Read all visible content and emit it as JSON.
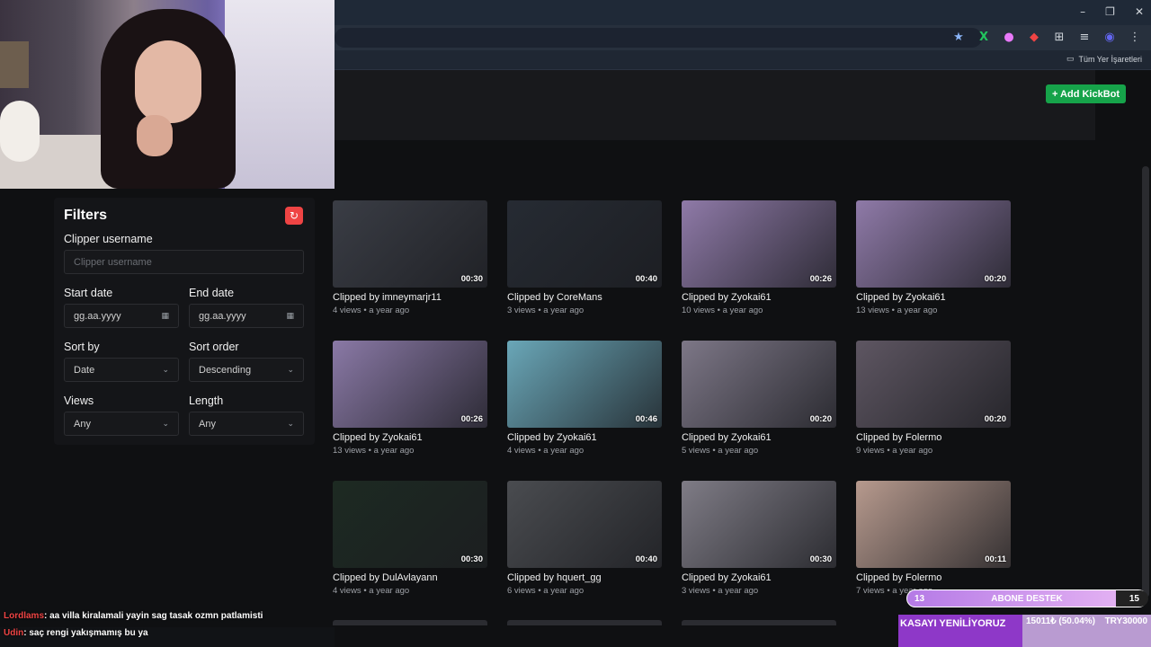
{
  "browser": {
    "bookmark_label": "Tüm Yer İşaretleri",
    "extensions": [
      "star-icon",
      "x-ext-icon",
      "pink-ext-icon",
      "red-ext-icon",
      "puzzle-icon",
      "media-icon",
      "profile-icon",
      "menu-icon"
    ],
    "window_controls": [
      "–",
      "❐",
      "✕"
    ]
  },
  "header": {
    "add_button_label": "+ Add KickBot"
  },
  "filters": {
    "title": "Filters",
    "clipper_label": "Clipper username",
    "clipper_placeholder": "Clipper username",
    "start_label": "Start date",
    "start_value": "gg.aa.yyyy",
    "end_label": "End date",
    "end_value": "gg.aa.yyyy",
    "sortby_label": "Sort by",
    "sortby_value": "Date",
    "sortorder_label": "Sort order",
    "sortorder_value": "Descending",
    "views_label": "Views",
    "views_value": "Any",
    "length_label": "Length",
    "length_value": "Any"
  },
  "clips": [
    {
      "title": "Clipped by imneymarjr11",
      "meta": "4 views • a year ago",
      "duration": "00:30",
      "thumb": "#3a3d45"
    },
    {
      "title": "Clipped by CoreMans",
      "meta": "3 views • a year ago",
      "duration": "00:40",
      "thumb": "#262b33"
    },
    {
      "title": "Clipped by Zyokai61",
      "meta": "10 views • a year ago",
      "duration": "00:26",
      "thumb": "#8f7aa8"
    },
    {
      "title": "Clipped by Zyokai61",
      "meta": "13 views • a year ago",
      "duration": "00:20",
      "thumb": "#8f7aa8"
    },
    {
      "title": "Clipped by Zyokai61",
      "meta": "13 views • a year ago",
      "duration": "00:26",
      "thumb": "#8a79a6"
    },
    {
      "title": "Clipped by Zyokai61",
      "meta": "4 views • a year ago",
      "duration": "00:46",
      "thumb": "#6aa7b8"
    },
    {
      "title": "Clipped by Zyokai61",
      "meta": "5 views • a year ago",
      "duration": "00:20",
      "thumb": "#7d7787"
    },
    {
      "title": "Clipped by Folermo",
      "meta": "9 views • a year ago",
      "duration": "00:20",
      "thumb": "#5e5662"
    },
    {
      "title": "Clipped by DulAvlayann",
      "meta": "4 views • a year ago",
      "duration": "00:30",
      "thumb": "#1d2a22"
    },
    {
      "title": "Clipped by hquert_gg",
      "meta": "6 views • a year ago",
      "duration": "00:40",
      "thumb": "#4a4c50"
    },
    {
      "title": "Clipped by Zyokai61",
      "meta": "3 views • a year ago",
      "duration": "00:30",
      "thumb": "#7f7c86"
    },
    {
      "title": "Clipped by Folermo",
      "meta": "7 views • a year ago",
      "duration": "00:11",
      "thumb": "#b79a8e"
    }
  ],
  "overlay": {
    "chat_line1_user": "Lordlams",
    "chat_line1_text": ": aa villa kiralamali yayin sag tasak ozmn patlamisti",
    "chat_line2_user": "Udin",
    "chat_line2_text": ": saç rengi yakışmamış bu ya",
    "donate_left": "13",
    "donate_label": "ABONE DESTEK",
    "donate_right": "15",
    "goal_label": "KASAYI YENİLİYORUZ",
    "goal_amount": "15011₺ (50.04%)",
    "goal_target": "TRY30000"
  }
}
